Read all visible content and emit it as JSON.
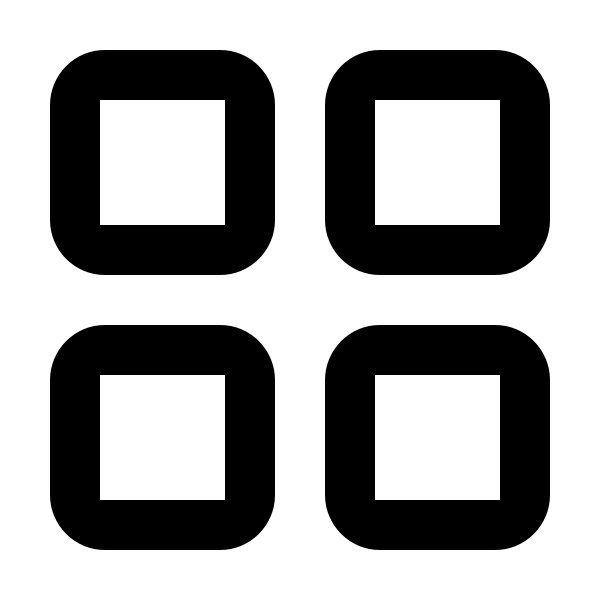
{
  "icon": {
    "name": "grid-icon",
    "color": "#000000",
    "background": "#ffffff",
    "tiles": [
      {
        "name": "grid-tile-top-left"
      },
      {
        "name": "grid-tile-top-right"
      },
      {
        "name": "grid-tile-bottom-left"
      },
      {
        "name": "grid-tile-bottom-right"
      }
    ]
  }
}
